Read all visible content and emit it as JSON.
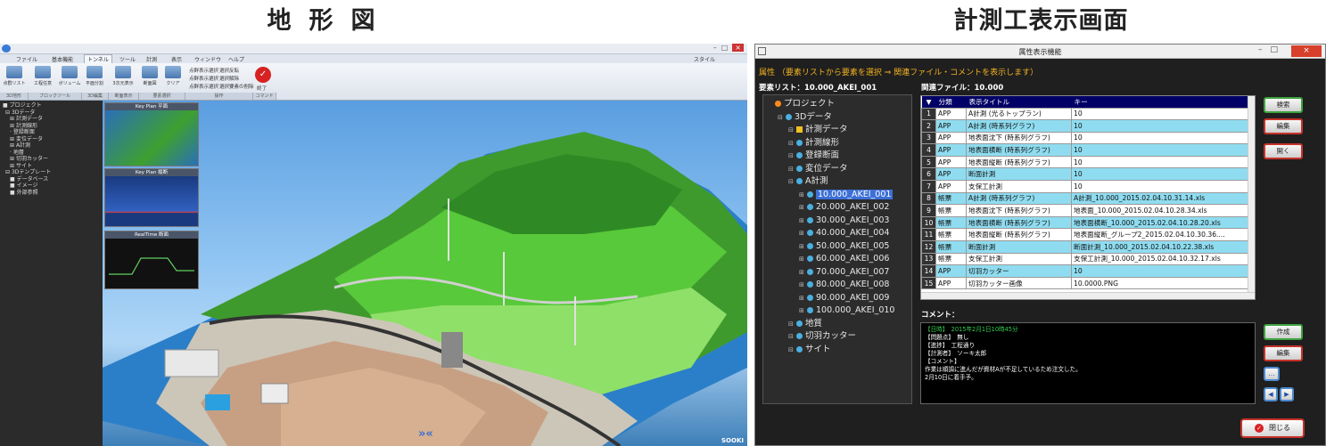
{
  "captions": {
    "left": "地形図",
    "right": "計測工表示画面"
  },
  "terrain_app": {
    "window_controls": {
      "minimize": "–",
      "maximize": "□",
      "close": "×"
    },
    "tabs": [
      "ファイル",
      "基本機能",
      "トンネル",
      "ツール",
      "計測",
      "表示",
      "ウィンドウ",
      "ヘルプ"
    ],
    "style_menu": "スタイル",
    "ribbon": {
      "buttons": [
        "点群リスト",
        "工程任意",
        "ボリューム",
        "平面分割",
        "3次元表示",
        "断面図",
        "クリア"
      ],
      "menu_items": [
        "点群表示選択",
        "選択反転",
        "点群表示選択",
        "選択解除",
        "点群表示選択",
        "選択要素の削除"
      ],
      "stop_label": "終了",
      "groups": [
        "3D地形",
        "ブロックツール",
        "3D編集",
        "断面表示",
        "要素選択",
        "操作",
        "コマンド"
      ]
    },
    "tree": [
      "プロジェクト",
      "3Dデータ",
      "計測データ",
      "計測線形",
      "登録断面",
      "変位データ",
      "A計測",
      "地層",
      "切羽カッター",
      "サイト",
      "3Dテンプレート",
      "データベース",
      "イメージ",
      "外部参照"
    ],
    "keyplans": [
      "Key Plan 平面",
      "Key Plan 縦断",
      "RealTime 断面"
    ],
    "status_logo": "SOOKI"
  },
  "attribute_window": {
    "title": "属性表示機能",
    "window_controls": {
      "minimize": "–",
      "maximize": "□",
      "close": "×"
    },
    "instruction": "属性 （要素リストから要素を選択 ⇒ 関連ファイル・コメントを表示します）",
    "element_list_label": "要素リスト：10.000_AKEI_001",
    "related_file_label": "関連ファイル：10.000",
    "tree": [
      {
        "label": "プロジェクト",
        "indent": 0,
        "icon": "project"
      },
      {
        "label": "3Dデータ",
        "indent": 1,
        "icon": "data"
      },
      {
        "label": "計測データ",
        "indent": 2,
        "icon": "folder"
      },
      {
        "label": "計測線形",
        "indent": 2,
        "icon": "data"
      },
      {
        "label": "登録断面",
        "indent": 2,
        "icon": "data"
      },
      {
        "label": "変位データ",
        "indent": 2,
        "icon": "data"
      },
      {
        "label": "A計測",
        "indent": 2,
        "icon": "data"
      },
      {
        "label": "10.000_AKEI_001",
        "indent": 3,
        "icon": "data",
        "selected": true
      },
      {
        "label": "20.000_AKEI_002",
        "indent": 3,
        "icon": "data"
      },
      {
        "label": "30.000_AKEI_003",
        "indent": 3,
        "icon": "data"
      },
      {
        "label": "40.000_AKEI_004",
        "indent": 3,
        "icon": "data"
      },
      {
        "label": "50.000_AKEI_005",
        "indent": 3,
        "icon": "data"
      },
      {
        "label": "60.000_AKEI_006",
        "indent": 3,
        "icon": "data"
      },
      {
        "label": "70.000_AKEI_007",
        "indent": 3,
        "icon": "data"
      },
      {
        "label": "80.000_AKEI_008",
        "indent": 3,
        "icon": "data"
      },
      {
        "label": "90.000_AKEI_009",
        "indent": 3,
        "icon": "data"
      },
      {
        "label": "100.000_AKEI_010",
        "indent": 3,
        "icon": "data"
      },
      {
        "label": "地質",
        "indent": 2,
        "icon": "data"
      },
      {
        "label": "切羽カッター",
        "indent": 2,
        "icon": "data"
      },
      {
        "label": "サイト",
        "indent": 2,
        "icon": "data"
      }
    ],
    "table": {
      "headers": [
        "▼",
        "分類",
        "表示タイトル",
        "キー"
      ],
      "rows": [
        {
          "no": "1",
          "cat": "APP",
          "title": "A計測 (光るトップラン)",
          "key": "10",
          "hl": false
        },
        {
          "no": "2",
          "cat": "APP",
          "title": "A計測 (時系列グラフ)",
          "key": "10",
          "hl": true
        },
        {
          "no": "3",
          "cat": "APP",
          "title": "地表面沈下 (時系列グラフ)",
          "key": "10",
          "hl": false
        },
        {
          "no": "4",
          "cat": "APP",
          "title": "地表面横断 (時系列グラフ)",
          "key": "10",
          "hl": true
        },
        {
          "no": "5",
          "cat": "APP",
          "title": "地表面縦断 (時系列グラフ)",
          "key": "10",
          "hl": false
        },
        {
          "no": "6",
          "cat": "APP",
          "title": "断面計測",
          "key": "10",
          "hl": true
        },
        {
          "no": "7",
          "cat": "APP",
          "title": "支保工計測",
          "key": "10",
          "hl": false
        },
        {
          "no": "8",
          "cat": "帳票",
          "title": "A計測 (時系列グラフ)",
          "key": "A計測_10.000_2015.02.04.10.31.14.xls",
          "hl": true
        },
        {
          "no": "9",
          "cat": "帳票",
          "title": "地表面沈下 (時系列グラフ)",
          "key": "地表面_10.000_2015.02.04.10.28.34.xls",
          "hl": false
        },
        {
          "no": "10",
          "cat": "帳票",
          "title": "地表面横断 (時系列グラフ)",
          "key": "地表面横断_10.000_2015.02.04.10.28.20.xls",
          "hl": true
        },
        {
          "no": "11",
          "cat": "帳票",
          "title": "地表面縦断 (時系列グラフ)",
          "key": "地表面縦断_グループ2_2015.02.04.10.30.36....",
          "hl": false
        },
        {
          "no": "12",
          "cat": "帳票",
          "title": "断面計測",
          "key": "断面計測_10.000_2015.02.04.10.22.38.xls",
          "hl": true
        },
        {
          "no": "13",
          "cat": "帳票",
          "title": "支保工計測",
          "key": "支保工計測_10.000_2015.02.04.10.32.17.xls",
          "hl": false
        },
        {
          "no": "14",
          "cat": "APP",
          "title": "切羽カッター",
          "key": "10",
          "hl": true
        },
        {
          "no": "15",
          "cat": "APP",
          "title": "切羽カッター画像",
          "key": "10.0000.PNG",
          "hl": false
        }
      ]
    },
    "buttons": {
      "search": "検索",
      "edit_top": "編集",
      "open": "開く",
      "create": "作成",
      "edit_bottom": "編集",
      "more": "…",
      "prev": "◀",
      "next": "▶",
      "close": "閉じる"
    },
    "comment_label": "コメント：",
    "comment_lines": [
      {
        "text": "【日時】　2015年2月1日10時45分",
        "date": true
      },
      {
        "text": "【問題点】　無し",
        "date": false
      },
      {
        "text": "【進捗】　工程通り",
        "date": false
      },
      {
        "text": "【計測者】　ソーキ太郎",
        "date": false
      },
      {
        "text": "【コメント】",
        "date": false
      },
      {
        "text": "作業は順調に進んだが資材Aが不足しているため注文した。",
        "date": false
      },
      {
        "text": "2月10日に着手予。",
        "date": false
      }
    ]
  }
}
